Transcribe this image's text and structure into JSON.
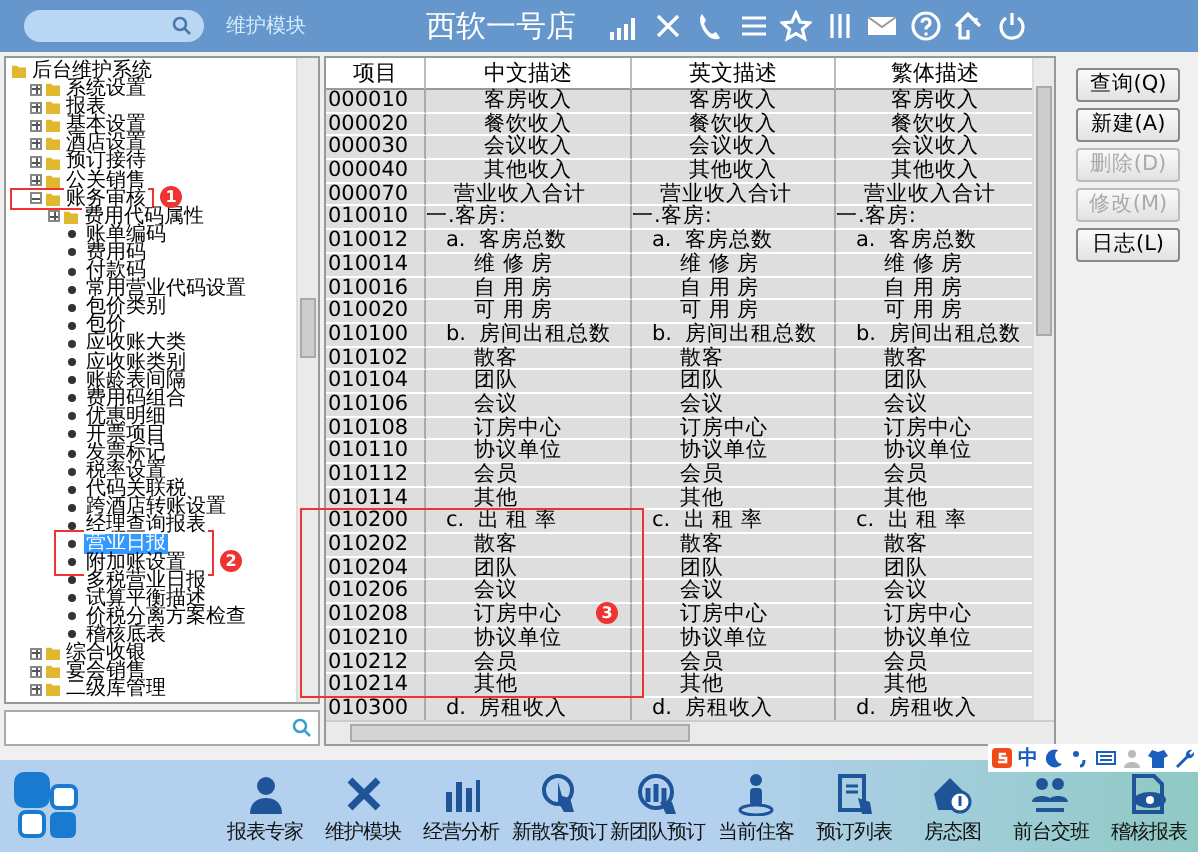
{
  "header": {
    "module": "维护模块",
    "title": "西软一号店"
  },
  "tree": {
    "label": "后台维护系统",
    "selected": false,
    "children": [
      {
        "label": "系统设置",
        "expanded": false,
        "selected": false
      },
      {
        "label": "报表",
        "expanded": false,
        "selected": false
      },
      {
        "label": "基本设置",
        "expanded": false,
        "selected": false
      },
      {
        "label": "酒店设置",
        "expanded": false,
        "selected": false
      },
      {
        "label": "预订接待",
        "expanded": false,
        "selected": false
      },
      {
        "label": "公关销售",
        "expanded": false,
        "selected": false
      },
      {
        "label": "账务审核",
        "expanded": true,
        "selected": false,
        "children": [
          {
            "label": "费用代码属性",
            "kind": "folder",
            "expanded": false,
            "selected": false
          },
          {
            "label": "账单编码",
            "kind": "leaf",
            "selected": false
          },
          {
            "label": "费用码",
            "kind": "leaf",
            "selected": false
          },
          {
            "label": "付款码",
            "kind": "leaf",
            "selected": false
          },
          {
            "label": "常用营业代码设置",
            "kind": "leaf",
            "selected": false
          },
          {
            "label": "包价类别",
            "kind": "leaf",
            "selected": false
          },
          {
            "label": "包价",
            "kind": "leaf",
            "selected": false
          },
          {
            "label": "应收账大类",
            "kind": "leaf",
            "selected": false
          },
          {
            "label": "应收账类别",
            "kind": "leaf",
            "selected": false
          },
          {
            "label": "账龄表间隔",
            "kind": "leaf",
            "selected": false
          },
          {
            "label": "费用码组合",
            "kind": "leaf",
            "selected": false
          },
          {
            "label": "优惠明细",
            "kind": "leaf",
            "selected": false
          },
          {
            "label": "开票项目",
            "kind": "leaf",
            "selected": false
          },
          {
            "label": "发票标记",
            "kind": "leaf",
            "selected": false
          },
          {
            "label": "税率设置",
            "kind": "leaf",
            "selected": false
          },
          {
            "label": "代码关联税",
            "kind": "leaf",
            "selected": false
          },
          {
            "label": "跨酒店转账设置",
            "kind": "leaf",
            "selected": false
          },
          {
            "label": "经理查询报表",
            "kind": "leaf",
            "selected": false
          },
          {
            "label": "营业日报",
            "kind": "leaf",
            "selected": true
          },
          {
            "label": "附加账设置",
            "kind": "leaf",
            "selected": false
          },
          {
            "label": "多税营业日报",
            "kind": "leaf",
            "selected": false
          },
          {
            "label": "试算平衡描述",
            "kind": "leaf",
            "selected": false
          },
          {
            "label": "价税分离方案检查",
            "kind": "leaf",
            "selected": false
          },
          {
            "label": "稽核底表",
            "kind": "leaf",
            "selected": false
          }
        ]
      },
      {
        "label": "综合收银",
        "expanded": false,
        "selected": false
      },
      {
        "label": "宴会销售",
        "expanded": false,
        "selected": false
      },
      {
        "label": "二级库管理",
        "expanded": false,
        "selected": false
      }
    ]
  },
  "table": {
    "columns": [
      "项目",
      "中文描述",
      "英文描述",
      "繁体描述"
    ],
    "rows": [
      {
        "kind": "total",
        "cells": [
          "000010",
          "客房收入",
          "客房收入",
          "客房收入"
        ]
      },
      {
        "kind": "total",
        "cells": [
          "000020",
          "餐饮收入",
          "餐饮收入",
          "餐饮收入"
        ]
      },
      {
        "kind": "total",
        "cells": [
          "000030",
          "会议收入",
          "会议收入",
          "会议收入"
        ]
      },
      {
        "kind": "total",
        "cells": [
          "000040",
          "其他收入",
          "其他收入",
          "其他收入"
        ]
      },
      {
        "kind": "grand",
        "cells": [
          "000070",
          "营业收入合计",
          "营业收入合计",
          "营业收入合计"
        ]
      },
      {
        "kind": "section",
        "cells": [
          "010010",
          "一.客房:",
          "一.客房:",
          "一.客房:"
        ]
      },
      {
        "kind": "sub",
        "cells": [
          "010012",
          "a.  客房总数",
          "a.  客房总数",
          "a.  客房总数"
        ]
      },
      {
        "kind": "item",
        "cells": [
          "010014",
          "维 修 房",
          "维 修 房",
          "维 修 房"
        ]
      },
      {
        "kind": "item",
        "cells": [
          "010016",
          "自 用 房",
          "自 用 房",
          "自 用 房"
        ]
      },
      {
        "kind": "item",
        "cells": [
          "010020",
          "可 用 房",
          "可 用 房",
          "可 用 房"
        ]
      },
      {
        "kind": "sub",
        "cells": [
          "010100",
          "b.  房间出租总数",
          "b.  房间出租总数",
          "b.  房间出租总数"
        ]
      },
      {
        "kind": "item",
        "cells": [
          "010102",
          "散客",
          "散客",
          "散客"
        ]
      },
      {
        "kind": "item",
        "cells": [
          "010104",
          "团队",
          "团队",
          "团队"
        ]
      },
      {
        "kind": "item",
        "cells": [
          "010106",
          "会议",
          "会议",
          "会议"
        ]
      },
      {
        "kind": "item",
        "cells": [
          "010108",
          "订房中心",
          "订房中心",
          "订房中心"
        ]
      },
      {
        "kind": "item",
        "cells": [
          "010110",
          "协议单位",
          "协议单位",
          "协议单位"
        ]
      },
      {
        "kind": "item",
        "cells": [
          "010112",
          "会员",
          "会员",
          "会员"
        ]
      },
      {
        "kind": "item",
        "cells": [
          "010114",
          "其他",
          "其他",
          "其他"
        ]
      },
      {
        "kind": "sub",
        "cells": [
          "010200",
          "c.  出 租 率",
          "c.  出 租 率",
          "c.  出 租 率"
        ]
      },
      {
        "kind": "item",
        "cells": [
          "010202",
          "散客",
          "散客",
          "散客"
        ]
      },
      {
        "kind": "item",
        "cells": [
          "010204",
          "团队",
          "团队",
          "团队"
        ]
      },
      {
        "kind": "item",
        "cells": [
          "010206",
          "会议",
          "会议",
          "会议"
        ]
      },
      {
        "kind": "item",
        "cells": [
          "010208",
          "订房中心",
          "订房中心",
          "订房中心"
        ]
      },
      {
        "kind": "item",
        "cells": [
          "010210",
          "协议单位",
          "协议单位",
          "协议单位"
        ]
      },
      {
        "kind": "item",
        "cells": [
          "010212",
          "会员",
          "会员",
          "会员"
        ]
      },
      {
        "kind": "item",
        "cells": [
          "010214",
          "其他",
          "其他",
          "其他"
        ]
      },
      {
        "kind": "sub",
        "cells": [
          "010300",
          "d.  房租收入",
          "d.  房租收入",
          "d.  房租收入"
        ]
      }
    ]
  },
  "actions": [
    {
      "label": "查询(Q)",
      "disabled": false
    },
    {
      "label": "新建(A)",
      "disabled": false
    },
    {
      "label": "删除(D)",
      "disabled": true
    },
    {
      "label": "修改(M)",
      "disabled": true
    },
    {
      "label": "日志(L)",
      "disabled": false
    }
  ],
  "annotations": [
    "1",
    "2",
    "3"
  ],
  "ime": {
    "mode": "中"
  },
  "toolbar": [
    "报表专家",
    "维护模块",
    "经营分析",
    "新散客预订",
    "新团队预订",
    "当前住客",
    "预订列表",
    "房态图",
    "前台交班",
    "稽核报表"
  ]
}
